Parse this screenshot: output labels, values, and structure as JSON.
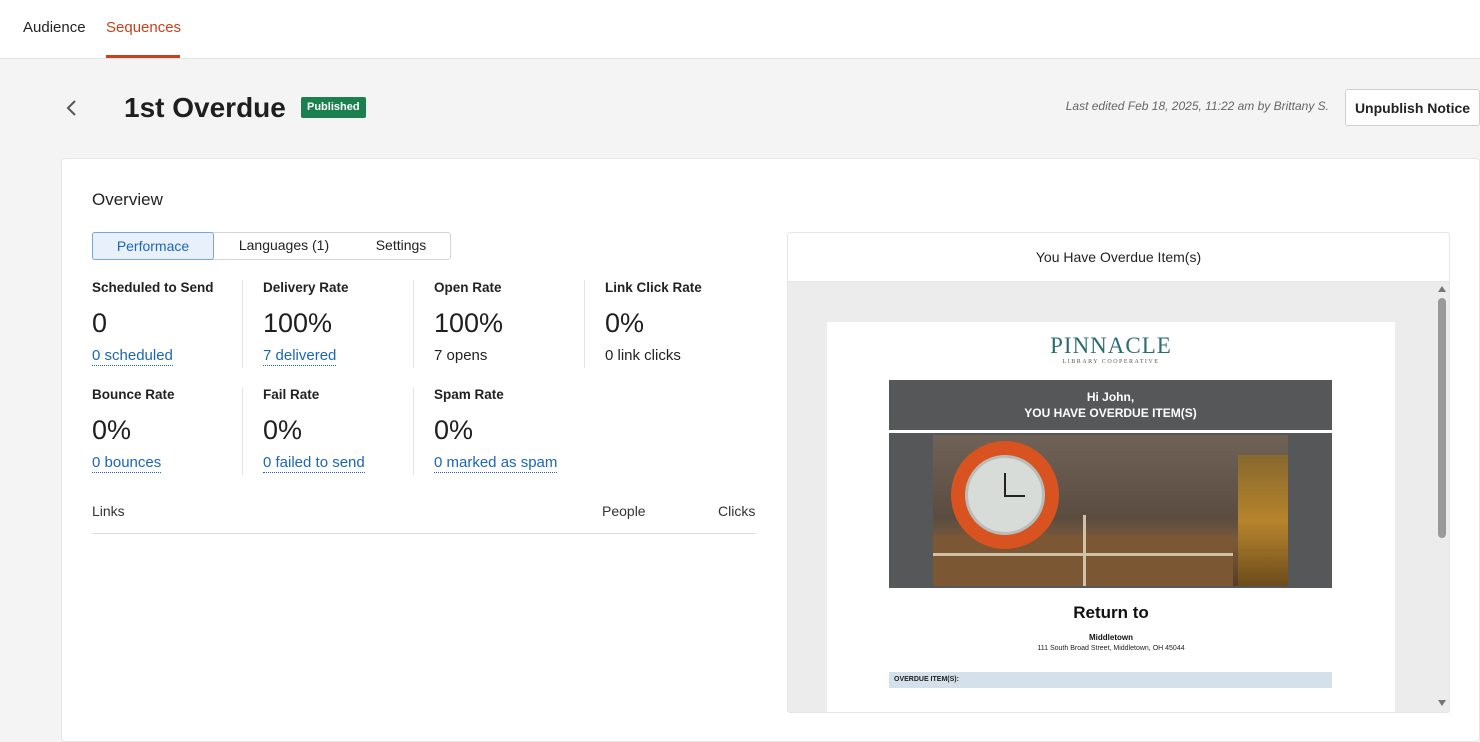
{
  "nav": {
    "tabs": [
      {
        "label": "Audience",
        "active": false
      },
      {
        "label": "Sequences",
        "active": true
      }
    ]
  },
  "header": {
    "title": "1st Overdue",
    "status_badge": "Published",
    "last_edited": "Last edited Feb 18, 2025, 11:22 am by Brittany  S.",
    "unpublish_label": "Unpublish Notice"
  },
  "overview": {
    "title": "Overview",
    "tabs": [
      {
        "label": "Performace",
        "active": true
      },
      {
        "label": "Languages (1)",
        "active": false
      },
      {
        "label": "Settings",
        "active": false
      }
    ],
    "metrics": [
      {
        "label": "Scheduled to Send",
        "value": "0",
        "sub": "0 scheduled",
        "sub_is_link": true
      },
      {
        "label": "Delivery Rate",
        "value": "100%",
        "sub": "7 delivered",
        "sub_is_link": true
      },
      {
        "label": "Open Rate",
        "value": "100%",
        "sub": "7 opens",
        "sub_is_link": false
      },
      {
        "label": "Link Click Rate",
        "value": "0%",
        "sub": "0 link clicks",
        "sub_is_link": false
      },
      {
        "label": "Bounce Rate",
        "value": "0%",
        "sub": "0 bounces",
        "sub_is_link": true
      },
      {
        "label": "Fail Rate",
        "value": "0%",
        "sub": "0 failed to send",
        "sub_is_link": true
      },
      {
        "label": "Spam Rate",
        "value": "0%",
        "sub": "0 marked as spam",
        "sub_is_link": true
      }
    ],
    "links_table": {
      "headers": [
        "Links",
        "People",
        "Clicks"
      ],
      "rows": []
    }
  },
  "preview": {
    "subject": "You Have Overdue Item(s)",
    "email": {
      "logo_main": "PINNACLE",
      "logo_sub": "LIBRARY COOPERATIVE",
      "greeting": "Hi John,",
      "headline": "YOU HAVE OVERDUE ITEM(S)",
      "return_heading": "Return to",
      "branch_name": "Middletown",
      "branch_address": "111 South Broad Street, Middletown, OH 45044",
      "overdue_label": "OVERDUE ITEM(S):"
    }
  },
  "colors": {
    "accent": "#c8411b",
    "published": "#1b7f4e",
    "link": "#1a66b8",
    "email_banner": "#555759",
    "logo": "#2a6e71"
  },
  "icons": {
    "back": "chevron-left-icon",
    "scroll_up": "triangle-up-icon",
    "scroll_down": "triangle-down-icon"
  }
}
